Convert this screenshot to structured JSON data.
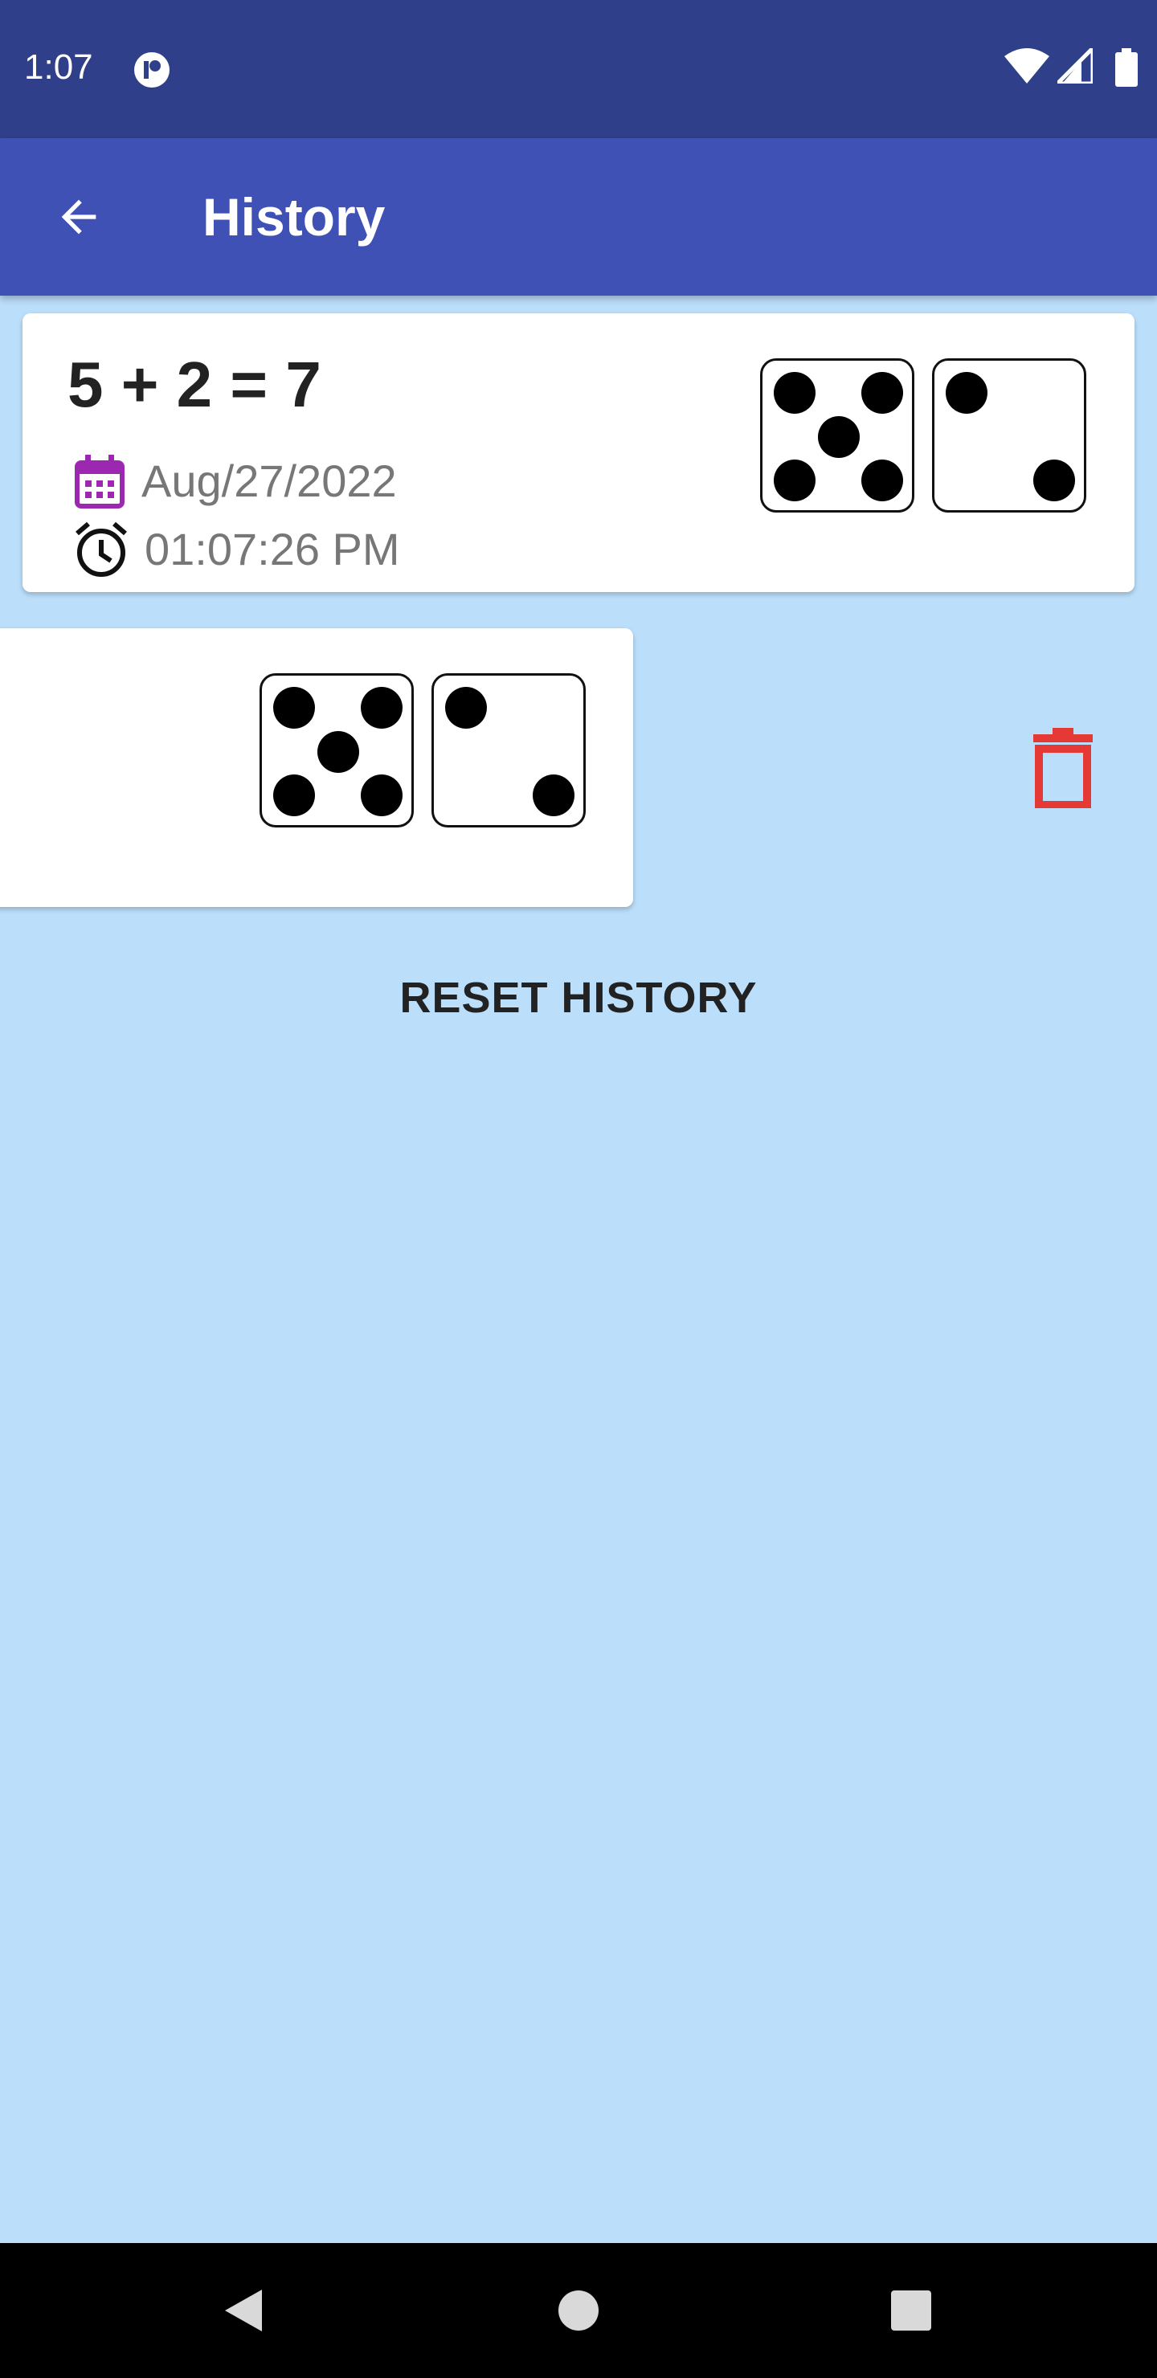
{
  "status_bar": {
    "time": "1:07",
    "icons": [
      "notification-icon",
      "wifi-icon",
      "cell-signal-icon",
      "battery-icon"
    ]
  },
  "app_bar": {
    "title": "History",
    "back_icon": "arrow-back-icon",
    "background": "#3f51b5",
    "status_background": "#303f8a"
  },
  "history": [
    {
      "equation": "5 + 2 = 7",
      "date": "Aug/27/2022",
      "time": "01:07:26 PM",
      "dice": [
        5,
        2
      ],
      "date_icon": "calendar-icon",
      "time_icon": "alarm-clock-icon"
    },
    {
      "dice": [
        5,
        2
      ],
      "state": "swiped-to-delete",
      "action_icon": "trash-icon",
      "action_color": "#e53935"
    }
  ],
  "actions": {
    "reset_label": "RESET HISTORY"
  },
  "nav_bar": {
    "icons": [
      "back-triangle-icon",
      "home-circle-icon",
      "recents-square-icon"
    ]
  },
  "colors": {
    "background": "#bbdefa",
    "accent_calendar": "#9c27b0",
    "delete": "#e53935"
  }
}
